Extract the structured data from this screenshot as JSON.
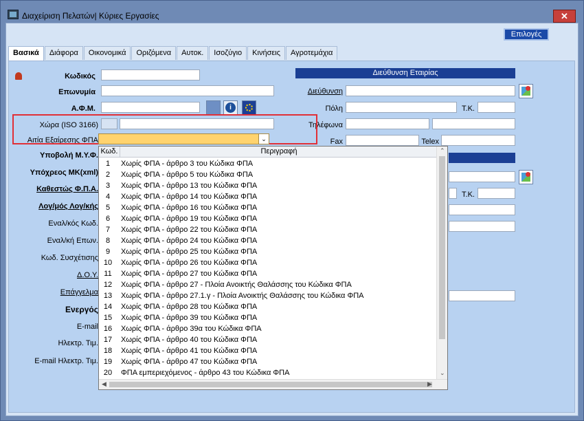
{
  "window": {
    "title": "Διαχείριση Πελατών| Κύριες Εργασίες",
    "close": "✕"
  },
  "toolbar": {
    "options": "Επιλογές"
  },
  "tabs": [
    "Βασικά",
    "Διάφορα",
    "Οικονομικά",
    "Οριζόμενα",
    "Αυτοκ.",
    "Ισοζύγιο",
    "Κινήσεις",
    "Αγροτεμάχια"
  ],
  "form": {
    "code": "Κωδικός",
    "name": "Επωνυμία",
    "afm": "Α.Φ.Μ.",
    "country": "Χώρα (ISO 3166)",
    "vat_reason": "Αιτία Εξαίρεσης ΦΠΑ",
    "myf": "Υποβολή Μ.Υ.Φ.",
    "mk": "Υπόχρεος ΜΚ(xml)",
    "vat_regime": "Καθεστώς Φ.Π.Α.",
    "account": "Λογ/μός Λογ/κής",
    "alt_code": "Εναλ/κός Κωδ.",
    "alt_name": "Εναλ/κή Επων.",
    "rel_code": "Κωδ. Συσχέτισης",
    "doy": "Δ.Ο.Υ.",
    "profession": "Επάγγελμα",
    "active": "Ενεργός",
    "email": "E-mail",
    "e_price": "Ηλεκτρ. Τιμ.",
    "e_email": "E-mail Ηλεκτρ. Τιμ."
  },
  "address": {
    "header": "Διεύθυνση Εταιρίας",
    "addr": "Διεύθυνση",
    "city": "Πόλη",
    "tk": "Τ.Κ.",
    "phones": "Τηλέφωνα",
    "fax": "Fax",
    "telex": "Telex",
    "tk2": "Τ.Κ."
  },
  "list": {
    "col_code": "Κωδ.",
    "col_desc": "Περιγραφή",
    "rows": [
      {
        "n": "1",
        "d": "Χωρίς ΦΠΑ - άρθρο 3 του Κώδικα ΦΠΑ"
      },
      {
        "n": "2",
        "d": "Χωρίς ΦΠΑ - άρθρο 5 του Κώδικα ΦΠΑ"
      },
      {
        "n": "3",
        "d": "Χωρίς ΦΠΑ - άρθρο 13 του Κώδικα ΦΠΑ"
      },
      {
        "n": "4",
        "d": "Χωρίς ΦΠΑ - άρθρο 14 του Κώδικα ΦΠΑ"
      },
      {
        "n": "5",
        "d": "Χωρίς ΦΠΑ - άρθρο 16 του Κώδικα ΦΠΑ"
      },
      {
        "n": "6",
        "d": "Χωρίς ΦΠΑ - άρθρο 19 του Κώδικα ΦΠΑ"
      },
      {
        "n": "7",
        "d": "Χωρίς ΦΠΑ - άρθρο 22 του Κώδικα ΦΠΑ"
      },
      {
        "n": "8",
        "d": "Χωρίς ΦΠΑ - άρθρο 24 του Κώδικα ΦΠΑ"
      },
      {
        "n": "9",
        "d": "Χωρίς ΦΠΑ - άρθρο 25 του Κώδικα ΦΠΑ"
      },
      {
        "n": "10",
        "d": "Χωρίς ΦΠΑ - άρθρο 26 του Κώδικα ΦΠΑ"
      },
      {
        "n": "11",
        "d": "Χωρίς ΦΠΑ - άρθρο 27 του Κώδικα ΦΠΑ"
      },
      {
        "n": "12",
        "d": "Χωρίς ΦΠΑ - άρθρο 27 - Πλοία Ανοικτής Θαλάσσης του Κώδικα ΦΠΑ"
      },
      {
        "n": "13",
        "d": "Χωρίς ΦΠΑ - άρθρο 27.1.γ - Πλοία Ανοικτής Θαλάσσης του Κώδικα ΦΠΑ"
      },
      {
        "n": "14",
        "d": "Χωρίς ΦΠΑ - άρθρο 28 του Κώδικα ΦΠΑ"
      },
      {
        "n": "15",
        "d": "Χωρίς ΦΠΑ - άρθρο 39 του Κώδικα ΦΠΑ"
      },
      {
        "n": "16",
        "d": "Χωρίς ΦΠΑ - άρθρο 39α του Κώδικα ΦΠΑ"
      },
      {
        "n": "17",
        "d": "Χωρίς ΦΠΑ - άρθρο 40 του Κώδικα ΦΠΑ"
      },
      {
        "n": "18",
        "d": "Χωρίς ΦΠΑ - άρθρο 41 του Κώδικα ΦΠΑ"
      },
      {
        "n": "19",
        "d": "Χωρίς ΦΠΑ - άρθρο 47 του Κώδικα ΦΠΑ"
      },
      {
        "n": "20",
        "d": "ΦΠΑ εμπεριεχόμενος - άρθρο 43 του Κώδικα ΦΠΑ"
      }
    ]
  }
}
